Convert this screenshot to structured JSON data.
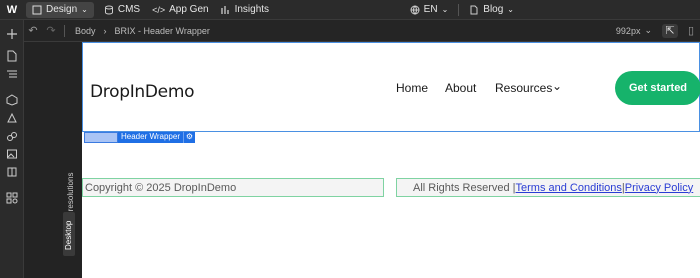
{
  "topbar": {
    "logo": "W",
    "mode": "Design",
    "cms": "CMS",
    "app_gen": "App Gen",
    "insights": "Insights",
    "locale": "EN",
    "page": "Blog"
  },
  "subbar": {
    "breadcrumb_root": "Body",
    "breadcrumb_current": "BRIX - Header Wrapper",
    "breakpoint": "992px"
  },
  "gutter": {
    "affects": "Affects all resolutions",
    "device": "Desktop"
  },
  "site": {
    "brand": "DropInDemo",
    "nav": [
      "Home",
      "About",
      "Resources"
    ],
    "cta": "Get started",
    "selection_label": "Header Wrapper",
    "copyright": "Copyright © 2025 DropInDemo",
    "rights": "All Rights Reserved | ",
    "terms": "Terms and Conditions",
    "divider": " | ",
    "privacy": "Privacy Policy"
  },
  "colors": {
    "accent": "#16b36b",
    "selection": "#1f6fe5",
    "link": "#2a3dd4"
  }
}
